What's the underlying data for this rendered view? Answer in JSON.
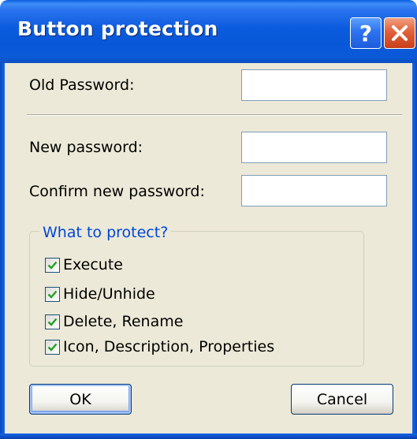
{
  "window": {
    "title": "Button protection",
    "help_glyph": "?",
    "close_icon": "close-icon",
    "accent_color": "#0a5fe0"
  },
  "fields": {
    "old_password_label": "Old Password:",
    "old_password_value": "",
    "new_password_label": "New password:",
    "new_password_value": "",
    "confirm_password_label": "Confirm new password:",
    "confirm_password_value": ""
  },
  "protect": {
    "title": "What to protect?",
    "title_color": "#0046d5",
    "items": [
      {
        "label": "Execute",
        "checked": true
      },
      {
        "label": "Hide/Unhide",
        "checked": true
      },
      {
        "label": "Delete, Rename",
        "checked": true
      },
      {
        "label": "Icon, Description, Properties",
        "checked": true
      }
    ]
  },
  "buttons": {
    "ok_label": "OK",
    "cancel_label": "Cancel"
  }
}
